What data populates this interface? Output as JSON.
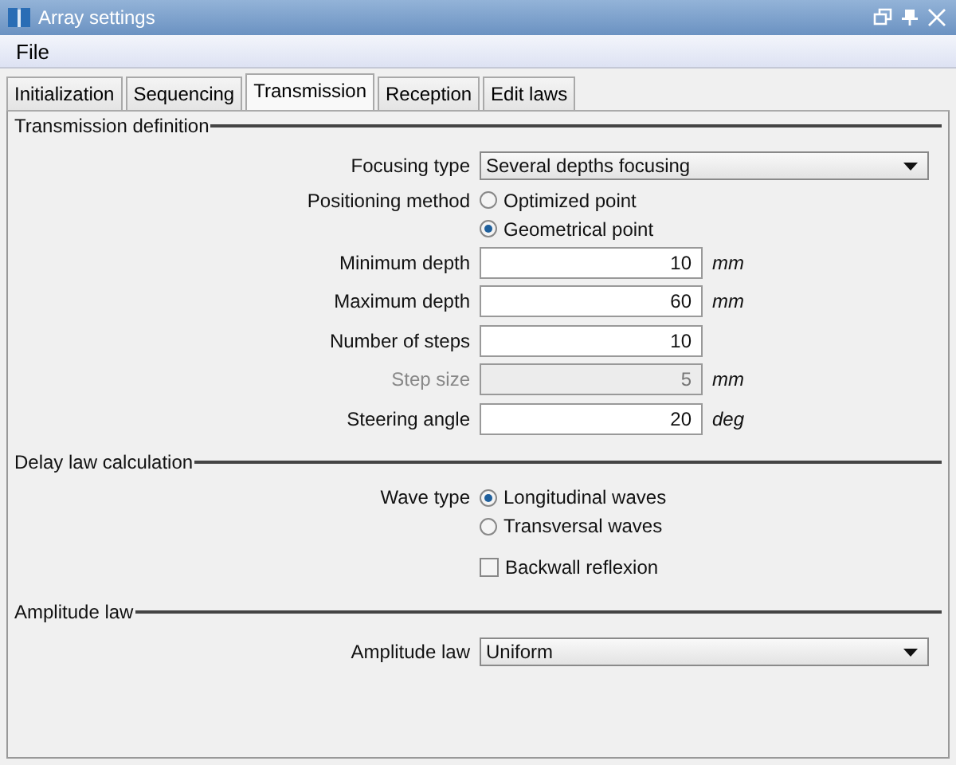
{
  "window": {
    "title": "Array settings"
  },
  "menu": [
    "File"
  ],
  "tabs": [
    {
      "label": "Initialization",
      "selected": false
    },
    {
      "label": "Sequencing",
      "selected": false
    },
    {
      "label": "Transmission",
      "selected": true
    },
    {
      "label": "Reception",
      "selected": false
    },
    {
      "label": "Edit laws",
      "selected": false
    }
  ],
  "sections": [
    {
      "title": "Transmission definition",
      "rows": [
        {
          "kind": "select",
          "label": "Focusing type",
          "value": "Several depths focusing"
        },
        {
          "kind": "radio",
          "label": "Positioning method",
          "options": [
            {
              "label": "Optimized point",
              "selected": false
            },
            {
              "label": "Geometrical point",
              "selected": true
            }
          ]
        },
        {
          "kind": "number",
          "label": "Minimum depth",
          "value": "10",
          "unit": "mm",
          "disabled": false
        },
        {
          "kind": "number",
          "label": "Maximum depth",
          "value": "60",
          "unit": "mm",
          "disabled": false
        },
        {
          "kind": "number",
          "label": "Number of steps",
          "value": "10",
          "disabled": false
        },
        {
          "kind": "number",
          "label": "Step size",
          "value": "5",
          "unit": "mm",
          "disabled": true
        },
        {
          "kind": "number",
          "label": "Steering angle",
          "value": "20",
          "unit": "deg",
          "disabled": false
        }
      ]
    },
    {
      "title": "Delay law calculation",
      "rows": [
        {
          "kind": "radio",
          "label": "Wave type",
          "options": [
            {
              "label": "Longitudinal waves",
              "selected": true
            },
            {
              "label": "Transversal waves",
              "selected": false
            }
          ]
        },
        {
          "kind": "checkbox",
          "label": "Backwall reflexion",
          "checked": false
        }
      ]
    },
    {
      "title": "Amplitude law",
      "rows": [
        {
          "kind": "select",
          "label": "Amplitude law",
          "value": "Uniform"
        }
      ]
    }
  ]
}
